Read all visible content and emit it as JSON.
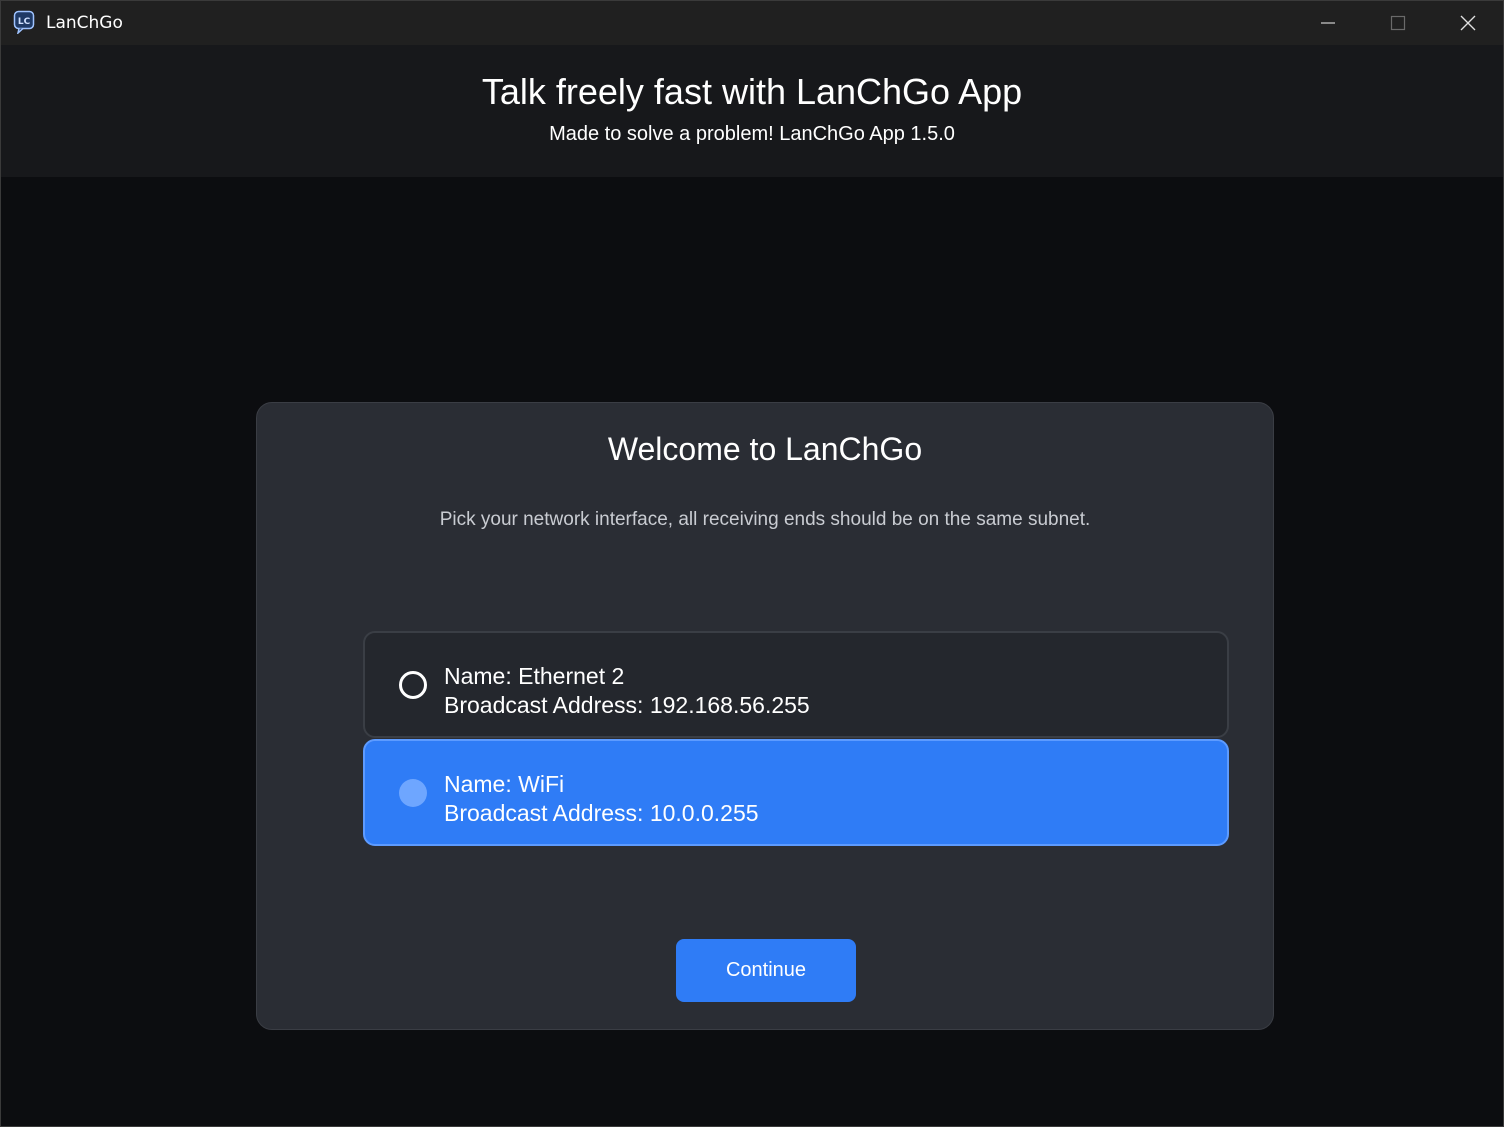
{
  "window": {
    "title": "LanChGo",
    "icon": "lanchgo-app-icon",
    "controls": [
      "minimize-icon",
      "maximize-icon",
      "close-icon"
    ]
  },
  "header": {
    "title": "Talk freely fast with LanChGo App",
    "subtitle": "Made to solve a problem! LanChGo App 1.5.0"
  },
  "welcome": {
    "title": "Welcome to LanChGo",
    "description": "Pick your network interface, all receiving ends should be on the same subnet.",
    "interfaces": [
      {
        "name": "Name: Ethernet 2",
        "broadcast": "Broadcast Address: 192.168.56.255",
        "selected": false
      },
      {
        "name": "Name: WiFi",
        "broadcast": "Broadcast Address: 10.0.0.255",
        "selected": true
      }
    ],
    "continue_label": "Continue"
  },
  "colors": {
    "accent": "#2f7cf6",
    "background": "#0c0d10",
    "card": "#2a2d34"
  }
}
